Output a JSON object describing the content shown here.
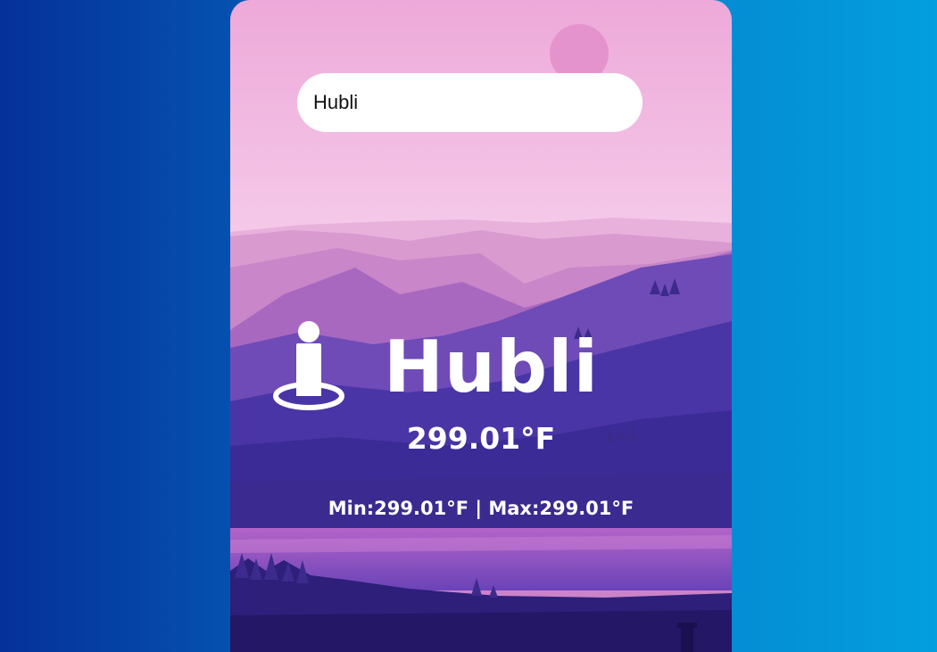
{
  "search": {
    "value": "Hubli"
  },
  "weather": {
    "city": "Hubli",
    "temperature": "299.01°F",
    "min_max": "Min:299.01°F | Max:299.01°F"
  },
  "icons": {
    "location": "person-pin-icon"
  },
  "colors": {
    "bg_left": "#05319a",
    "bg_right": "#039fdf",
    "text": "#ffffff"
  }
}
